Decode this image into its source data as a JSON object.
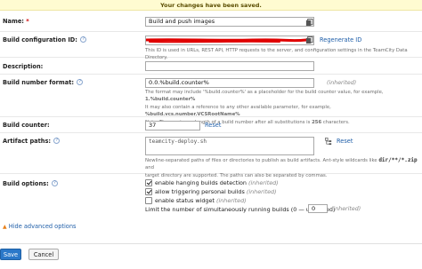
{
  "banner": {
    "message": "Your changes have been saved."
  },
  "name": {
    "label": "Name:",
    "required_mark": "*",
    "value": "Build and push images"
  },
  "build_config_id": {
    "label": "Build configuration ID:",
    "regenerate_label": "Regenerate ID",
    "note": "This ID is used in URLs, REST API, HTTP requests to the server, and configuration settings in the TeamCity Data Directory."
  },
  "description": {
    "label": "Description:",
    "value": ""
  },
  "build_number_format": {
    "label": "Build number format:",
    "value": "0.0.%build.counter%",
    "inherited": "(inherited)",
    "note_line1_pre": "The format may include '%build.counter%' as a placeholder for the build counter value, for example,",
    "note_line1_example": "1.%build.counter%",
    "note_line2_pre": "It may also contain a reference to any other available parameter, for example,",
    "note_line2_example": "%build.vcs.number.VCSRootName%",
    "note_line3_pre": "Note: The maximum length of a build number after all substitutions is",
    "note_line3_number": "256",
    "note_line3_post": "characters."
  },
  "build_counter": {
    "label": "Build counter:",
    "value": "37",
    "reset_label": "Reset"
  },
  "artifact_paths": {
    "label": "Artifact paths:",
    "value": "teamcity-deploy.sh",
    "reset_label": "Reset",
    "note_line1_pre": "Newline-separated paths of files or directories to publish as build artifacts. Ant-style wildcards like",
    "note_line1_example": "dir/**/*.zip",
    "note_line1_post": "and",
    "note_line2": "target directory are supported. The paths can also be separated by commas."
  },
  "build_options": {
    "label": "Build options:",
    "options": [
      {
        "label": "enable hanging builds detection",
        "inherited": "(inherited)",
        "checked": true
      },
      {
        "label": "allow triggering personal builds",
        "inherited": "(inherited)",
        "checked": true
      },
      {
        "label": "enable status widget",
        "inherited": "(inherited)",
        "checked": false
      }
    ],
    "limit_label": "Limit the number of simultaneously running builds (0 — unlimited)",
    "limit_value": "0",
    "limit_inherited": "(inherited)"
  },
  "advanced": {
    "label": "Hide advanced options"
  },
  "buttons": {
    "save": "Save",
    "cancel": "Cancel"
  },
  "colors": {
    "accent": "#2b78c9",
    "link": "#1f5ea8",
    "banner_bg": "#fffbd1",
    "advanced_arrow": "#e8801a"
  }
}
